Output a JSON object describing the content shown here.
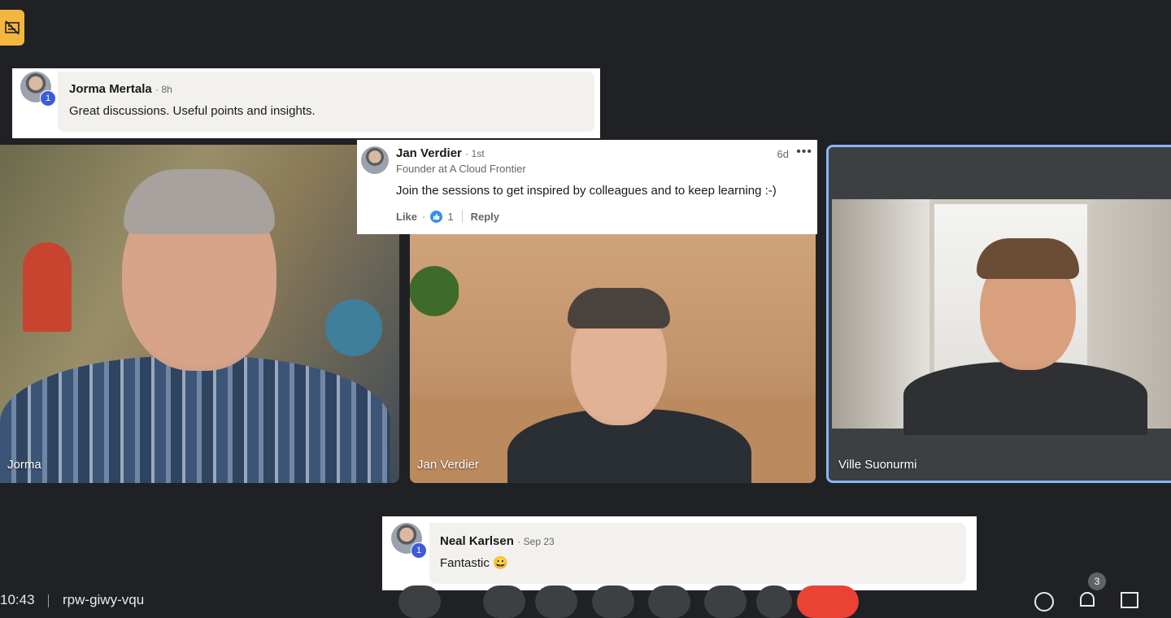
{
  "notice_badge": {
    "icon": "caption-off-icon",
    "color": "#f4b63f"
  },
  "comment_top": {
    "author": "Jorma Mertala",
    "time": "· 8h",
    "text": "Great discussions. Useful points and insights.",
    "badge": "1"
  },
  "comment_middle": {
    "author": "Jan Verdier",
    "degree": "· 1st",
    "headline": "Founder at A Cloud Frontier",
    "time": "6d",
    "text": "Join the sessions to get inspired by colleagues and to keep learning :-)",
    "like_label": "Like",
    "reaction_count": "1",
    "reply_label": "Reply"
  },
  "comment_bottom": {
    "author": "Neal Karlsen",
    "time": "· Sep 23",
    "text": "Fantastic 😀",
    "badge": "1"
  },
  "participants": [
    {
      "name": "Jorma"
    },
    {
      "name": "Jan Verdier"
    },
    {
      "name": "Ville Suonurmi"
    }
  ],
  "footer": {
    "clock": "10:43",
    "meeting_code": "rpw-giwy-vqu",
    "participant_count": "3"
  },
  "colors": {
    "accent_border": "#8ab4f8",
    "end_call": "#ea4335",
    "background": "#202124"
  }
}
